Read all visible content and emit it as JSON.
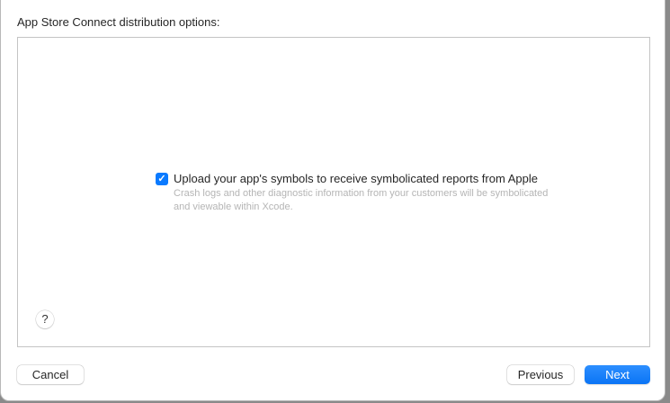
{
  "heading": "App Store Connect distribution options:",
  "options": [
    {
      "label": "Upload your app's symbols to receive symbolicated reports from Apple",
      "checked": true,
      "description": "Crash logs and other diagnostic information from your customers will be symbolicated and viewable within Xcode."
    }
  ],
  "icons": {
    "checkbox": "✓",
    "help": "?"
  },
  "buttons": {
    "cancel": "Cancel",
    "previous": "Previous",
    "next": "Next"
  },
  "colors": {
    "accent": "#0a7aff"
  }
}
